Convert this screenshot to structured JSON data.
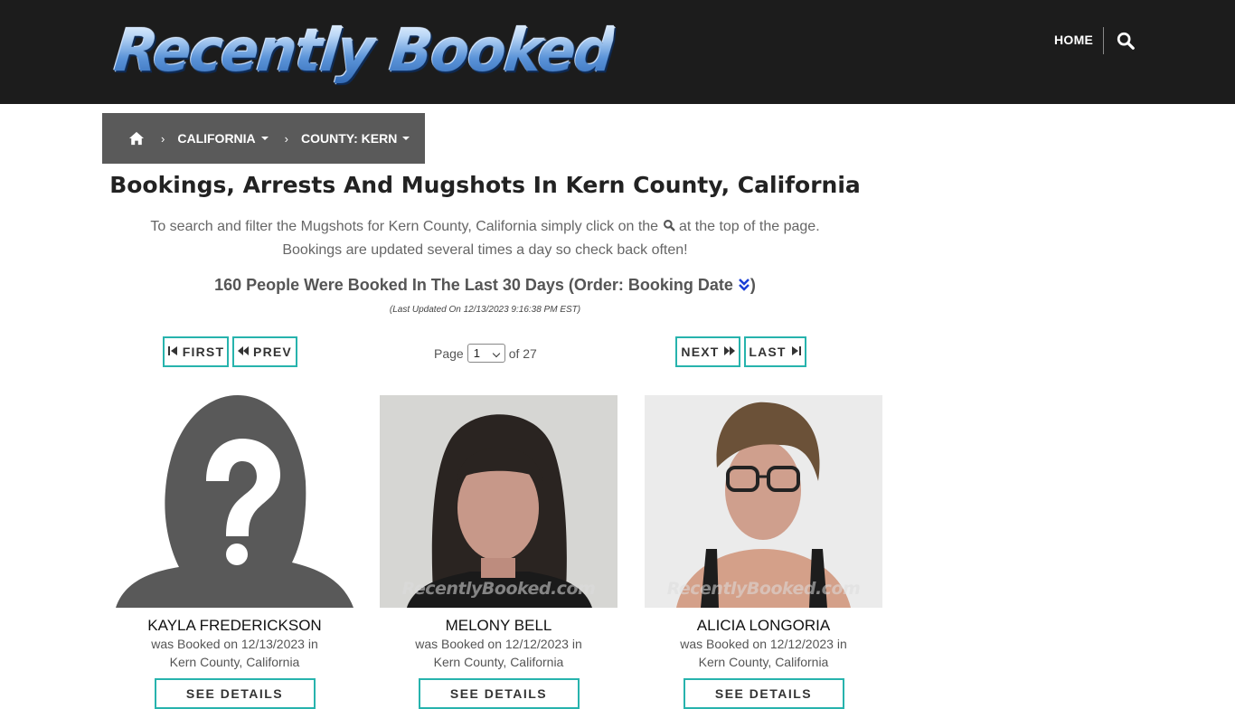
{
  "header": {
    "logo_text": "Recently Booked",
    "nav_home": "HOME",
    "search_icon": "search-icon"
  },
  "breadcrumb": {
    "home_icon": "home-icon",
    "separator": "›",
    "state": "CALIFORNIA",
    "county": "COUNTY: KERN"
  },
  "main": {
    "title": "Bookings, Arrests And Mugshots In Kern County, California",
    "intro_part1": "To search and filter the Mugshots for Kern County, California simply click on the",
    "intro_part2": "at the top of the page.",
    "intro_line2": "Bookings are updated several times a day so check back often!",
    "count_text": "160 People Were Booked In The Last 30 Days (Order: Booking Date",
    "count_close": ")",
    "last_updated": "(Last Updated On 12/13/2023 9:16:38 PM EST)"
  },
  "pagination": {
    "first": "FIRST",
    "prev": "PREV",
    "next": "NEXT",
    "last": "LAST",
    "page_label": "Page",
    "current_page": "1",
    "of_label": "of 27",
    "accent_color": "#27b3ad"
  },
  "cards": [
    {
      "name": "KAYLA FREDERICKSON",
      "booked_line1": "was Booked on 12/13/2023 in",
      "booked_line2": "Kern County, California",
      "details": "SEE DETAILS",
      "photo": "placeholder-silhouette"
    },
    {
      "name": "MELONY BELL",
      "booked_line1": "was Booked on 12/12/2023 in",
      "booked_line2": "Kern County, California",
      "details": "SEE DETAILS",
      "photo": "mugshot",
      "watermark": "RecentlyBooked.com"
    },
    {
      "name": "ALICIA LONGORIA",
      "booked_line1": "was Booked on 12/12/2023 in",
      "booked_line2": "Kern County, California",
      "details": "SEE DETAILS",
      "photo": "mugshot",
      "watermark": "RecentlyBooked.com"
    }
  ]
}
